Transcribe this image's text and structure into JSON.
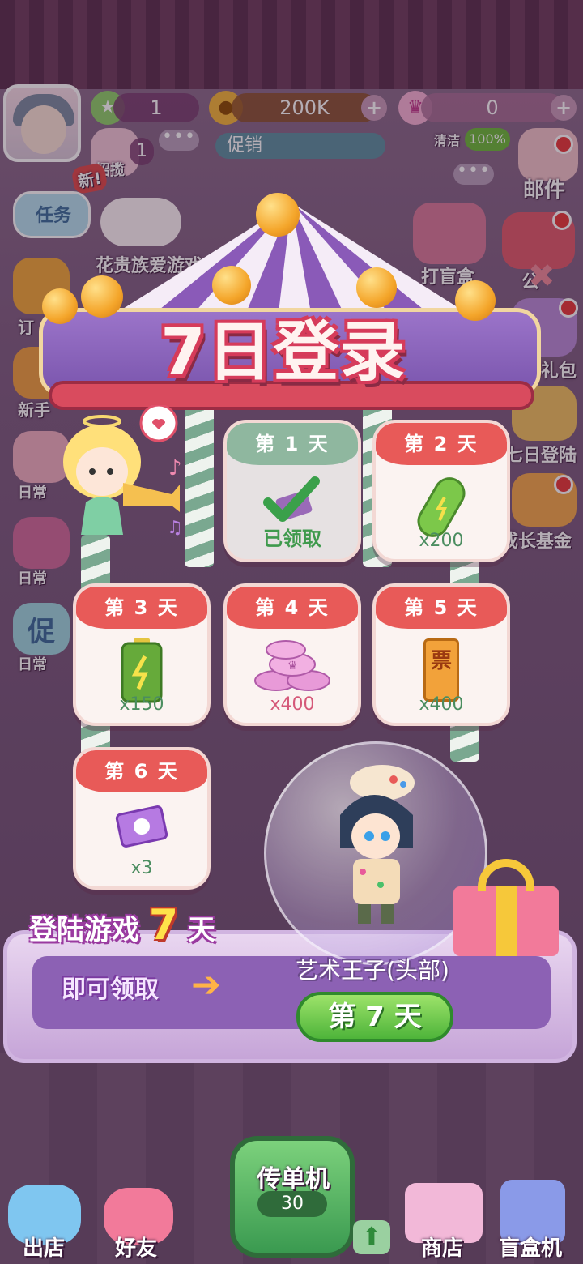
{
  "top_bar": {
    "stars": "1",
    "coins": "200K",
    "crowns": "0",
    "invite_count": "1",
    "invite_label": "招揽",
    "promo_label": "促销",
    "clean_label": "清洁",
    "clean_percent": "100%",
    "new_badge": "新!"
  },
  "left_sidebar": {
    "task_label": "任务",
    "bubble_text": "花贵族爱游戏",
    "order_label": "订",
    "novice_label": "新手",
    "daily1_label": "日常",
    "daily2_label": "日常",
    "promo_label": "促",
    "daily3_label": "日常"
  },
  "right_sidebar": {
    "mail_label": "邮件",
    "announce_label": "公",
    "blindbox_label": "打盲盒",
    "first_recharge_label": "首充礼包",
    "seven_day_label": "七日登陆",
    "growth_fund_label": "成长基金"
  },
  "event": {
    "title": "7日登录",
    "days": [
      {
        "label": "第 1 天",
        "status": "已领取",
        "amount": ""
      },
      {
        "label": "第 2 天",
        "status": "",
        "amount": "x200"
      },
      {
        "label": "第 3 天",
        "status": "",
        "amount": "x150"
      },
      {
        "label": "第 4 天",
        "status": "",
        "amount": "x400"
      },
      {
        "label": "第 5 天",
        "status": "",
        "amount": "x400"
      },
      {
        "label": "第 6 天",
        "status": "",
        "amount": "x3"
      }
    ],
    "ticket_char": "票",
    "promo_line1_a": "登陆游戏",
    "promo_line1_num": "7",
    "promo_line1_b": "天",
    "promo_line2": "即可领取",
    "grand_prize_name": "艺术王子(头部)",
    "grand_prize_day": "第 7 天"
  },
  "bottom_nav": {
    "out_store": "出店",
    "friends": "好友",
    "flyer": "传单机",
    "flyer_count": "30",
    "shop": "商店",
    "blindbox_machine": "盲盒机"
  },
  "colors": {
    "day_header_red": "#e85a58",
    "day_header_claimed": "#8fb79f",
    "amount_green": "#4b8d60",
    "amount_pink": "#d55879",
    "accent_purple": "#8c61b4"
  }
}
